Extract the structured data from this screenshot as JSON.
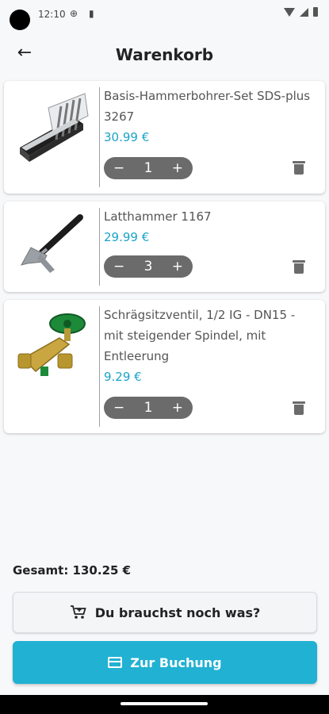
{
  "status_bar": {
    "time": "12:10"
  },
  "header": {
    "title": "Warenkorb"
  },
  "cart": {
    "items": [
      {
        "name": "Basis-Hammerbohrer-Set SDS-plus 3267",
        "price": "30.99 €",
        "quantity": "1"
      },
      {
        "name": "Latthammer 1167",
        "price": "29.99 €",
        "quantity": "3"
      },
      {
        "name": "Schrägsitzventil, 1/2 IG - DN15 - mit steigender Spindel, mit Entleerung",
        "price": "9.29 €",
        "quantity": "1"
      }
    ],
    "stepper": {
      "minus": "−",
      "plus": "+"
    }
  },
  "summary": {
    "total": "Gesamt: 130.25 €"
  },
  "buttons": {
    "more": "Du brauchst noch was?",
    "checkout": "Zur Buchung"
  },
  "colors": {
    "accent": "#21b1d3",
    "price": "#1aa3c9",
    "stepper": "#6b6b6b"
  }
}
